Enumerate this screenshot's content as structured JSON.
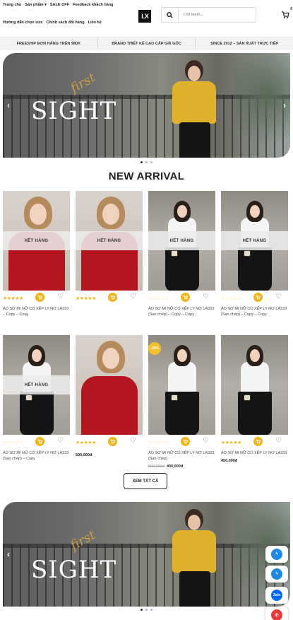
{
  "header": {
    "nav_top": [
      "Trang chủ",
      "Sản phẩm",
      "SALE OFF",
      "Feedback khách hàng"
    ],
    "nav_bottom": [
      "Hướng dẫn chọn size",
      "Chính sách đổi hàng",
      "Liên hệ"
    ],
    "logo_text": "LX",
    "search_placeholder": "Tìm kiếm...",
    "cart_count": "0"
  },
  "info_bar": [
    "FREESHIP ĐƠN HÀNG TRÊN 980K",
    "BRAND THIẾT KẾ CAO CẤP GIÁ GỐC",
    "SINCE 2012 – SẢN XUẤT TRỰC TIẾP"
  ],
  "banner": {
    "script_text": "first",
    "title_text": "SIGHT"
  },
  "section_title": "NEW ARRIVAL",
  "products": [
    {
      "name": "ÁO SƠ MI NỮ CỔ XẾP LY NƠ LA333 – Copy – Copy",
      "sold_out": "HẾT HÀNG",
      "stars": "filled",
      "style": "red",
      "price": ""
    },
    {
      "name": "",
      "sold_out": "HẾT HÀNG",
      "stars": "filled",
      "style": "red",
      "price": ""
    },
    {
      "name": "ÁO SƠ MI NỮ CỔ XẾP LY NƠ LA333 (Sao chép) – Copy – Copy",
      "sold_out": "HẾT HÀNG",
      "stars": "empty",
      "style": "white",
      "price": ""
    },
    {
      "name": "ÁO SƠ MI NỮ CỔ XẾP LY NƠ LA333 (Sao chép) – Copy – Copy",
      "sold_out": "HẾT HÀNG",
      "stars": "empty",
      "style": "white",
      "price": ""
    },
    {
      "name": "ÁO SƠ MI NỮ CỔ XẾP LY NƠ LA333 (Sao chép) – Copy",
      "sold_out": "HẾT HÀNG",
      "stars": "empty",
      "style": "white",
      "price": ""
    },
    {
      "name": "",
      "sold_out": "",
      "stars": "filled",
      "style": "red",
      "price": "500,000đ"
    },
    {
      "name": "ÁO SƠ MI NỮ CỔ XẾP LY NƠ LA333 (Sao chép)",
      "sold_out": "",
      "stars": "empty",
      "style": "white",
      "sale": "-20%",
      "old_price": "500,000đ",
      "price": "400,000đ"
    },
    {
      "name": "ÁO SƠ MI NỮ CỔ XẾP LY NƠ LA333",
      "sold_out": "",
      "stars": "filled",
      "style": "white",
      "price": "450,000đ"
    }
  ],
  "view_all_label": "XEM TẤT CẢ",
  "floating": [
    {
      "icon": "messenger-icon",
      "color": "#1e88e5",
      "label": ""
    },
    {
      "icon": "messenger-icon",
      "color": "#1e88e5",
      "label": ""
    },
    {
      "icon": "zalo-icon",
      "color": "#0068ff",
      "label": "Zalo"
    },
    {
      "icon": "phone-icon",
      "color": "#e53935",
      "label": ""
    }
  ]
}
